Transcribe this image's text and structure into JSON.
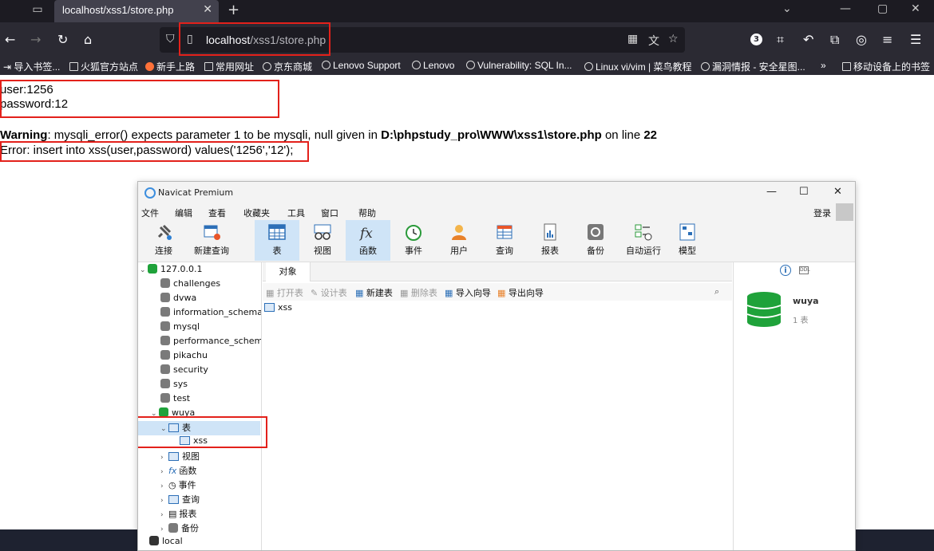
{
  "browser": {
    "tab_title": "localhost/xss1/store.php",
    "url_host": "localhost",
    "url_path": "/xss1/store.php",
    "extension_badge": "3",
    "bookmarks": [
      "导入书签...",
      "火狐官方站点",
      "新手上路",
      "常用网址",
      "京东商城",
      "Lenovo Support",
      "Lenovo",
      "Vulnerability: SQL In...",
      "Linux vi/vim | 菜鸟教程",
      "漏洞情报 - 安全星图...",
      "移动设备上的书签"
    ]
  },
  "page": {
    "line_user": "user:1256",
    "line_password": "password:12",
    "warning_label": "Warning",
    "warning_text": ": mysqli_error() expects parameter 1 to be mysqli, null given in ",
    "warning_path": "D:\\phpstudy_pro\\WWW\\xss1\\store.php",
    "warning_online": " on line ",
    "warning_line": "22",
    "error_line": "Error: insert into xss(user,password) values('1256','12');"
  },
  "navicat": {
    "title": "Navicat Premium",
    "menu": [
      "文件",
      "编辑",
      "查看",
      "收藏夹",
      "工具",
      "窗口",
      "帮助"
    ],
    "login": "登录",
    "toolbar": [
      "连接",
      "新建查询",
      "表",
      "视图",
      "函数",
      "事件",
      "用户",
      "查询",
      "报表",
      "备份",
      "自动运行",
      "模型"
    ],
    "tree": {
      "connection": "127.0.0.1",
      "databases": [
        "challenges",
        "dvwa",
        "information_schema",
        "mysql",
        "performance_schema",
        "pikachu",
        "security",
        "sys",
        "test",
        "wuya"
      ],
      "wuya_children": [
        "表",
        "视图",
        "函数",
        "事件",
        "查询",
        "报表",
        "备份"
      ],
      "table_item": "xss",
      "local_connection": "local"
    },
    "object_tab": "对象",
    "object_tools": [
      "打开表",
      "设计表",
      "新建表",
      "删除表",
      "导入向导",
      "导出向导"
    ],
    "object_item": "xss",
    "info": {
      "db_name": "wuya",
      "db_count": "1 表"
    }
  }
}
